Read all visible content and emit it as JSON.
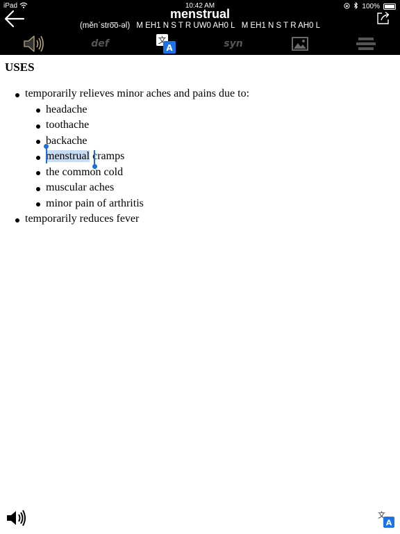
{
  "status_bar": {
    "device": "iPad",
    "time": "10:42 AM",
    "battery": "100%"
  },
  "header": {
    "word": "menstrual",
    "pronunciation": "(mĕnˈstro͞o-əl)",
    "arpabet_1": "M EH1 N S T R UW0 AH0 L",
    "arpabet_2": "M EH1 N S T R AH0 L"
  },
  "toolbar": {
    "tabs": [
      {
        "name": "audio",
        "icon": "speaker-icon"
      },
      {
        "name": "definition",
        "label": "def"
      },
      {
        "name": "translate",
        "icon": "translate-icon"
      },
      {
        "name": "synonyms",
        "label": "syn"
      },
      {
        "name": "images",
        "icon": "image-icon"
      },
      {
        "name": "menu",
        "icon": "menu-icon"
      }
    ]
  },
  "content": {
    "heading": "USES",
    "items": [
      {
        "text": "temporarily relieves minor aches and pains due to:",
        "subitems": [
          {
            "text": "headache"
          },
          {
            "text": "toothache"
          },
          {
            "text": "backache"
          },
          {
            "selected": "menstrual",
            "rest": " cramps"
          },
          {
            "text": "the common cold"
          },
          {
            "text": "muscular aches"
          },
          {
            "text": "minor pain of arthritis"
          }
        ]
      },
      {
        "text": "temporarily reduces fever"
      }
    ]
  },
  "colors": {
    "selection": "#c7dbf3",
    "selection_handle": "#1a6fd8",
    "toolbar_bg": "#000000",
    "translate_badge": "#1a73e8"
  }
}
